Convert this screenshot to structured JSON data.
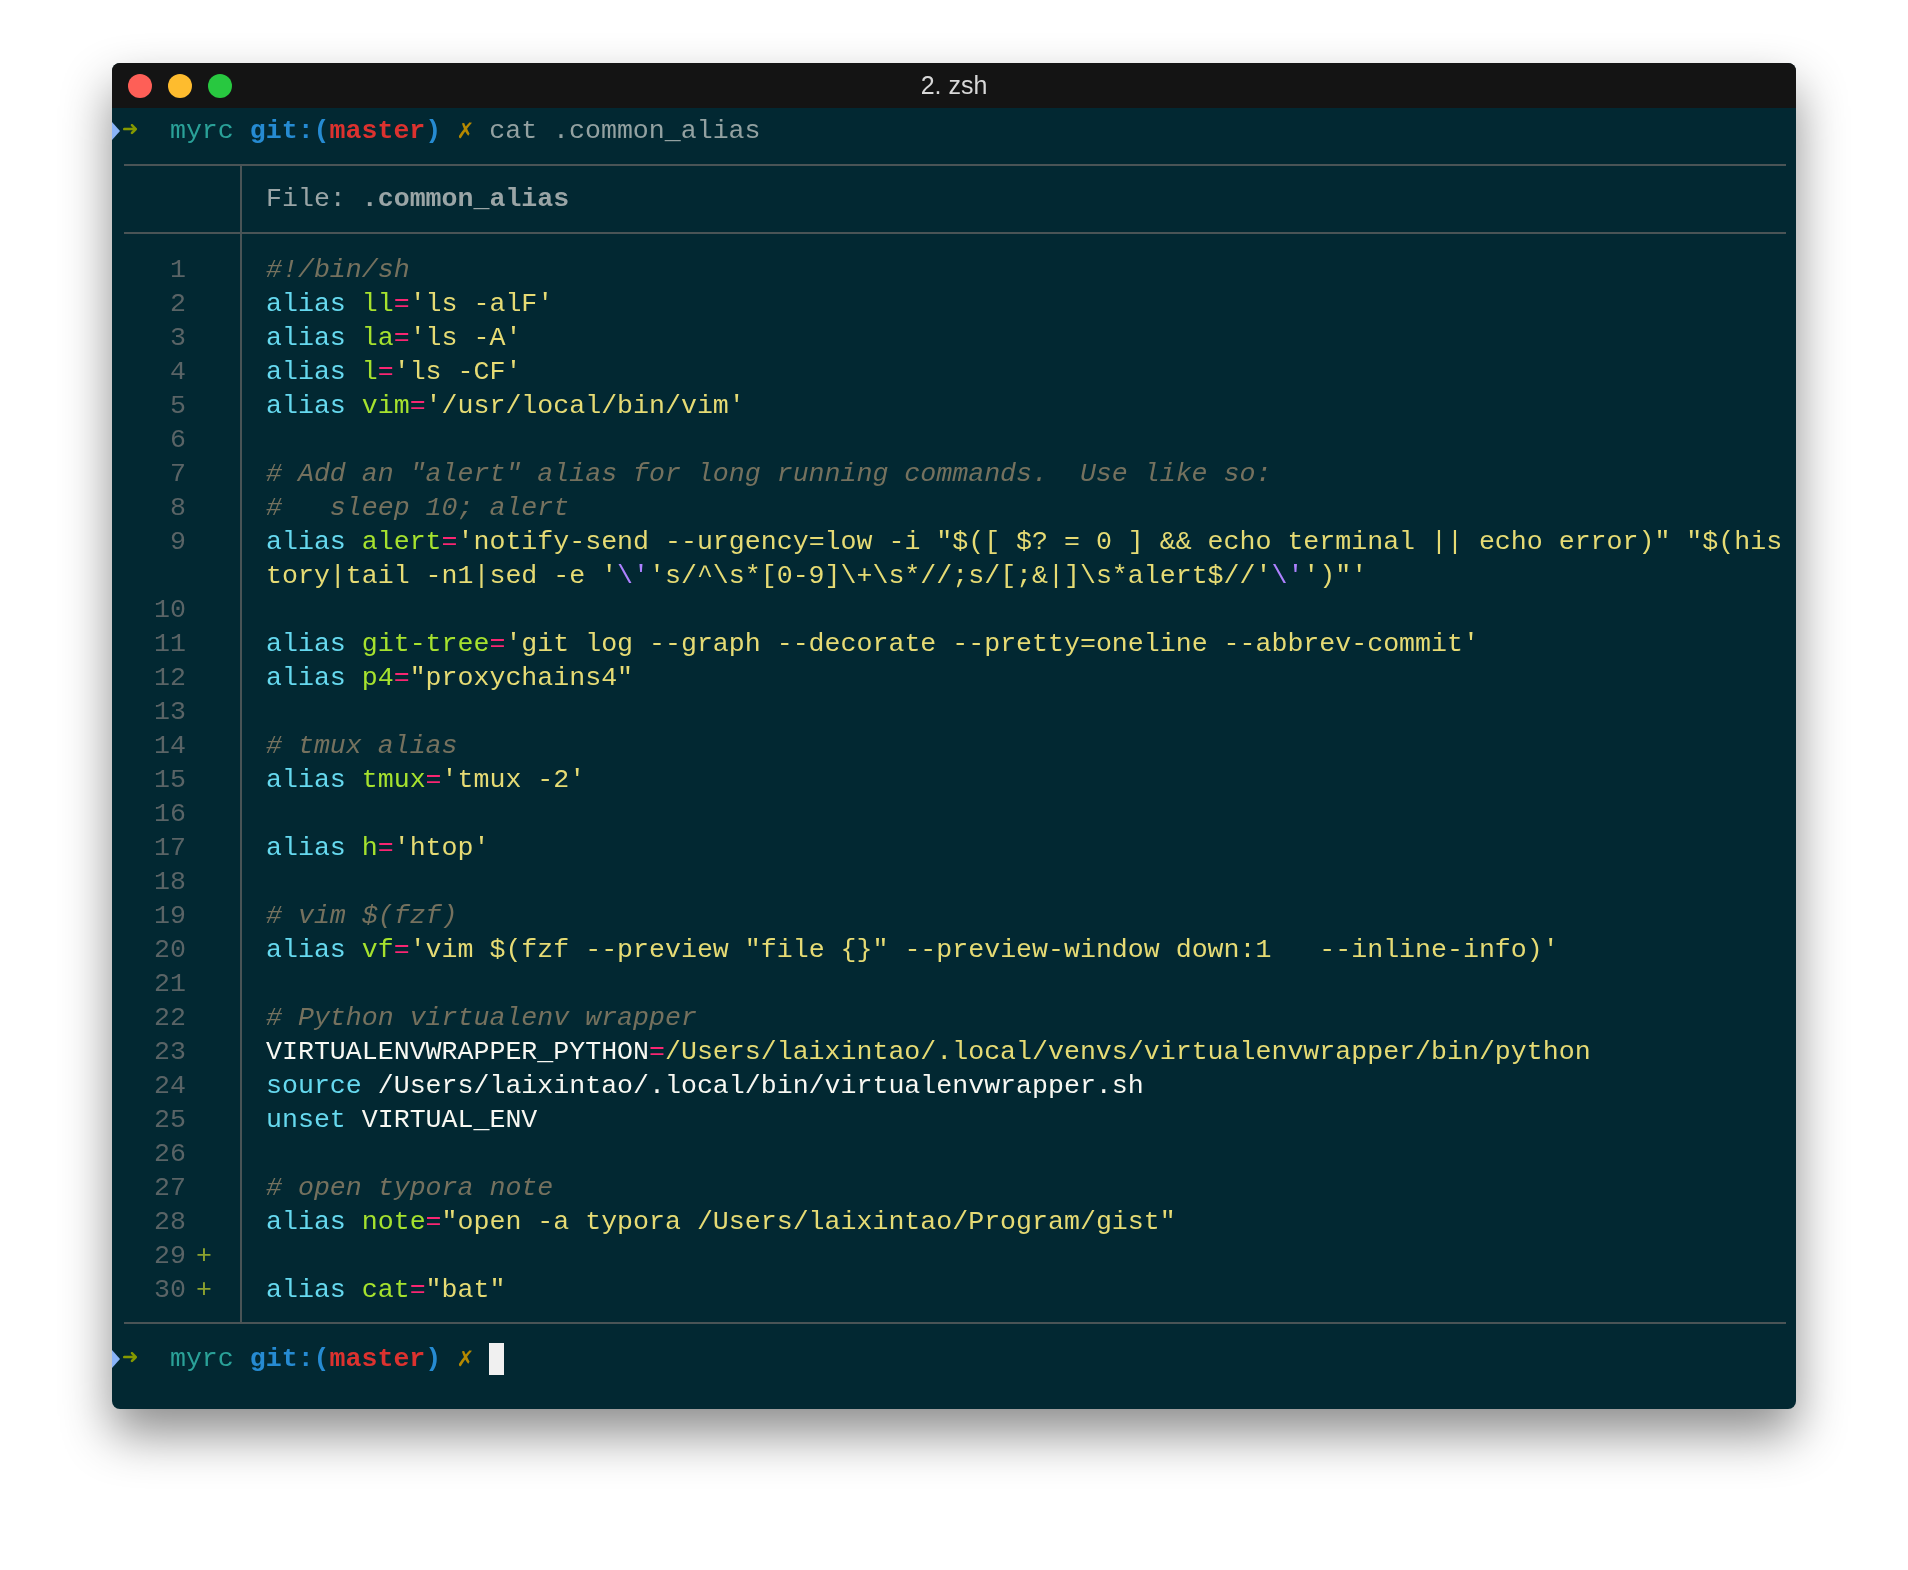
{
  "window": {
    "title": "2. zsh"
  },
  "command_prompt": {
    "arrow": "➜",
    "directory": "myrc",
    "git_open": "git:(",
    "branch": "master",
    "git_close": ")",
    "dirty_mark": "✗",
    "command": "cat .common_alias"
  },
  "file_header": {
    "label": "File: ",
    "name": ".common_alias"
  },
  "lines": [
    {
      "number": "1",
      "tokens": [
        {
          "kind": "comment",
          "text": "#!/bin/sh"
        }
      ]
    },
    {
      "number": "2",
      "tokens": [
        {
          "kind": "keyword",
          "text": "alias"
        },
        {
          "kind": "name",
          "text": " ll"
        },
        {
          "kind": "op",
          "text": "="
        },
        {
          "kind": "string",
          "text": "'ls -alF'"
        }
      ]
    },
    {
      "number": "3",
      "tokens": [
        {
          "kind": "keyword",
          "text": "alias"
        },
        {
          "kind": "name",
          "text": " la"
        },
        {
          "kind": "op",
          "text": "="
        },
        {
          "kind": "string",
          "text": "'ls -A'"
        }
      ]
    },
    {
      "number": "4",
      "tokens": [
        {
          "kind": "keyword",
          "text": "alias"
        },
        {
          "kind": "name",
          "text": " l"
        },
        {
          "kind": "op",
          "text": "="
        },
        {
          "kind": "string",
          "text": "'ls -CF'"
        }
      ]
    },
    {
      "number": "5",
      "tokens": [
        {
          "kind": "keyword",
          "text": "alias"
        },
        {
          "kind": "name",
          "text": " vim"
        },
        {
          "kind": "op",
          "text": "="
        },
        {
          "kind": "string",
          "text": "'/usr/local/bin/vim'"
        }
      ]
    },
    {
      "number": "6"
    },
    {
      "number": "7",
      "tokens": [
        {
          "kind": "comment",
          "text": "# Add an \"alert\" alias for long running commands.  Use like so:"
        }
      ]
    },
    {
      "number": "8",
      "tokens": [
        {
          "kind": "comment",
          "text": "#   sleep 10; alert"
        }
      ]
    },
    {
      "number": "9",
      "tokens": [
        {
          "kind": "keyword",
          "text": "alias"
        },
        {
          "kind": "name",
          "text": " alert"
        },
        {
          "kind": "op",
          "text": "="
        },
        {
          "kind": "string",
          "text": "'notify-send --urgency=low -i \"$([ $? = 0 ] && echo terminal || echo error)\" \"$(history|tail -n1|sed -e '"
        },
        {
          "kind": "escape",
          "text": "\\'"
        },
        {
          "kind": "string",
          "text": "'s/^\\s*[0-9]\\+\\s*//;s/[;&|]\\s*alert$//'"
        },
        {
          "kind": "escape",
          "text": "\\'"
        },
        {
          "kind": "string",
          "text": "')\"'"
        }
      ]
    },
    {
      "number": "10"
    },
    {
      "number": "11",
      "tokens": [
        {
          "kind": "keyword",
          "text": "alias"
        },
        {
          "kind": "name",
          "text": " git-tree"
        },
        {
          "kind": "op",
          "text": "="
        },
        {
          "kind": "string",
          "text": "'git log --graph --decorate --pretty=oneline --abbrev-commit'"
        }
      ]
    },
    {
      "number": "12",
      "tokens": [
        {
          "kind": "keyword",
          "text": "alias"
        },
        {
          "kind": "name",
          "text": " p4"
        },
        {
          "kind": "op",
          "text": "="
        },
        {
          "kind": "string",
          "text": "\"proxychains4\""
        }
      ]
    },
    {
      "number": "13"
    },
    {
      "number": "14",
      "tokens": [
        {
          "kind": "comment",
          "text": "# tmux alias"
        }
      ]
    },
    {
      "number": "15",
      "tokens": [
        {
          "kind": "keyword",
          "text": "alias"
        },
        {
          "kind": "name",
          "text": " tmux"
        },
        {
          "kind": "op",
          "text": "="
        },
        {
          "kind": "string",
          "text": "'tmux -2'"
        }
      ]
    },
    {
      "number": "16"
    },
    {
      "number": "17",
      "tokens": [
        {
          "kind": "keyword",
          "text": "alias"
        },
        {
          "kind": "name",
          "text": " h"
        },
        {
          "kind": "op",
          "text": "="
        },
        {
          "kind": "string",
          "text": "'htop'"
        }
      ]
    },
    {
      "number": "18"
    },
    {
      "number": "19",
      "tokens": [
        {
          "kind": "comment",
          "text": "# vim $(fzf)"
        }
      ]
    },
    {
      "number": "20",
      "tokens": [
        {
          "kind": "keyword",
          "text": "alias"
        },
        {
          "kind": "name",
          "text": " vf"
        },
        {
          "kind": "op",
          "text": "="
        },
        {
          "kind": "string",
          "text": "'vim $(fzf --preview \"file {}\" --preview-window down:1   --inline-info)'"
        }
      ]
    },
    {
      "number": "21"
    },
    {
      "number": "22",
      "tokens": [
        {
          "kind": "comment",
          "text": "# Python virtualenv wrapper"
        }
      ]
    },
    {
      "number": "23",
      "tokens": [
        {
          "kind": "plain",
          "text": "VIRTUALENVWRAPPER_PYTHON"
        },
        {
          "kind": "op",
          "text": "="
        },
        {
          "kind": "string",
          "text": "/Users/laixintao/.local/venvs/virtualenvwrapper/bin/python"
        }
      ]
    },
    {
      "number": "24",
      "tokens": [
        {
          "kind": "keyword",
          "text": "source"
        },
        {
          "kind": "plain",
          "text": " /Users/laixintao/.local/bin/virtualenvwrapper.sh"
        }
      ]
    },
    {
      "number": "25",
      "tokens": [
        {
          "kind": "keyword",
          "text": "unset"
        },
        {
          "kind": "plain",
          "text": " VIRTUAL_ENV"
        }
      ]
    },
    {
      "number": "26"
    },
    {
      "number": "27",
      "tokens": [
        {
          "kind": "comment",
          "text": "# open typora note"
        }
      ]
    },
    {
      "number": "28",
      "tokens": [
        {
          "kind": "keyword",
          "text": "alias"
        },
        {
          "kind": "name",
          "text": " note"
        },
        {
          "kind": "op",
          "text": "="
        },
        {
          "kind": "string",
          "text": "\"open -a typora /Users/laixintao/Program/gist\""
        }
      ]
    },
    {
      "number": "29",
      "marker": "+"
    },
    {
      "number": "30",
      "marker": "+",
      "tokens": [
        {
          "kind": "keyword",
          "text": "alias"
        },
        {
          "kind": "name",
          "text": " cat"
        },
        {
          "kind": "op",
          "text": "="
        },
        {
          "kind": "string",
          "text": "\"bat\""
        }
      ]
    }
  ],
  "final_prompt": {
    "arrow": "➜",
    "directory": "myrc",
    "git_open": "git:(",
    "branch": "master",
    "git_close": ")",
    "dirty_mark": "✗"
  }
}
